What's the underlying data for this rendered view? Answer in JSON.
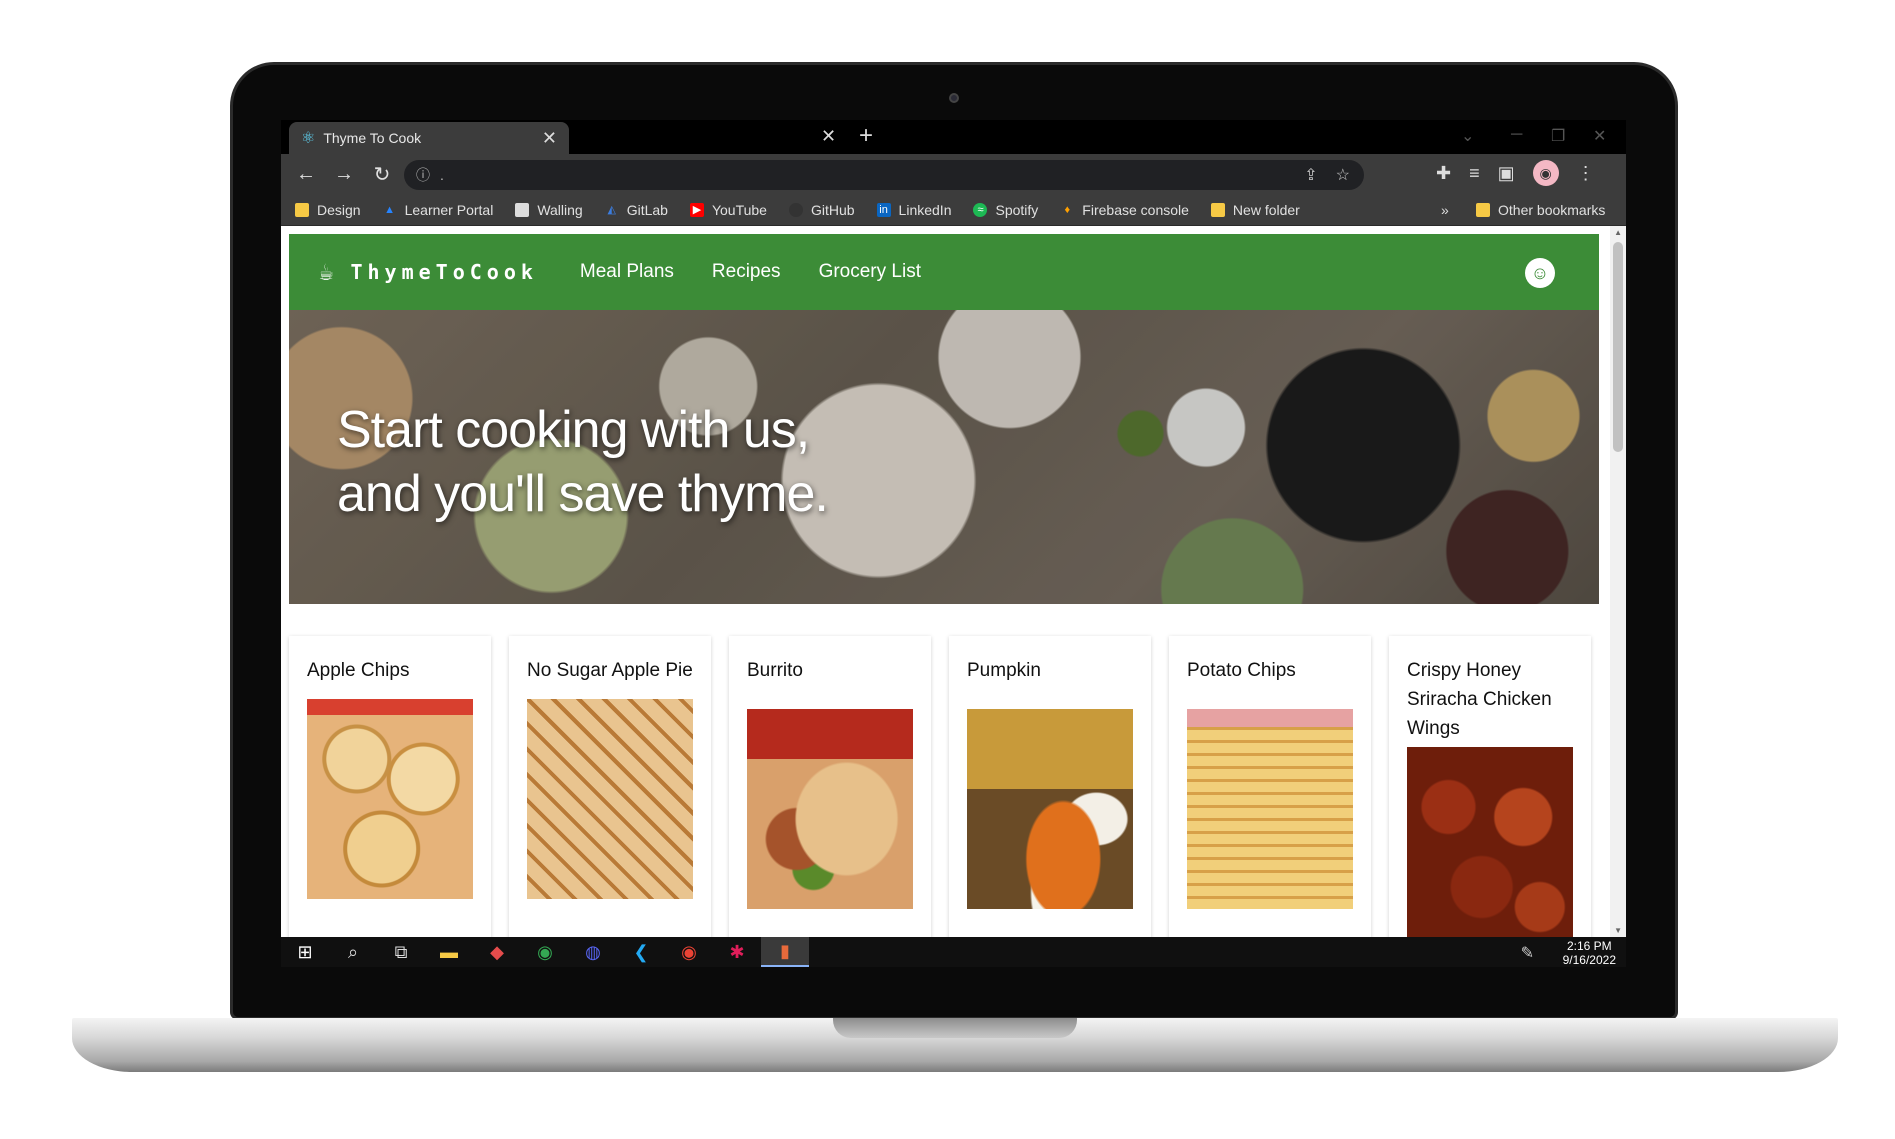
{
  "browser": {
    "tab_title": "Thyme To Cook",
    "address": ".",
    "bookmarks": [
      {
        "label": "Design",
        "icon": "folder-icon",
        "color": "#f6c945"
      },
      {
        "label": "Learner Portal",
        "icon": "atlassian-icon",
        "color": "#2684ff"
      },
      {
        "label": "Walling",
        "icon": "walling-icon",
        "color": "#dddddd"
      },
      {
        "label": "GitLab",
        "icon": "gitlab-icon",
        "color": "#1f4f9b"
      },
      {
        "label": "YouTube",
        "icon": "youtube-icon",
        "color": "#ff0000"
      },
      {
        "label": "GitHub",
        "icon": "github-icon",
        "color": "#333333"
      },
      {
        "label": "LinkedIn",
        "icon": "linkedin-icon",
        "color": "#0a66c2"
      },
      {
        "label": "Spotify",
        "icon": "spotify-icon",
        "color": "#1db954"
      },
      {
        "label": "Firebase console",
        "icon": "firebase-icon",
        "color": "#ffa000"
      },
      {
        "label": "New folder",
        "icon": "folder-icon",
        "color": "#f6c945"
      }
    ],
    "more_bookmarks": "»",
    "other_bookmarks": "Other bookmarks"
  },
  "site": {
    "brand": "ThymeToCook",
    "nav": [
      "Meal Plans",
      "Recipes",
      "Grocery List"
    ],
    "accent_color": "#3c8c37",
    "hero_line1": "Start cooking with us,",
    "hero_line2": "and you'll save thyme."
  },
  "recipes": [
    {
      "title": "Apple Chips",
      "image": "apple-chips"
    },
    {
      "title": "No Sugar Apple Pie",
      "image": "apple-pie"
    },
    {
      "title": "Burrito",
      "image": "burrito"
    },
    {
      "title": "Pumpkin",
      "image": "pumpkin"
    },
    {
      "title": "Potato Chips",
      "image": "potato-chips"
    },
    {
      "title": "Crispy Honey Sriracha Chicken Wings",
      "image": "chicken-wings"
    }
  ],
  "taskbar": {
    "time": "2:16 PM",
    "date": "9/16/2022"
  }
}
